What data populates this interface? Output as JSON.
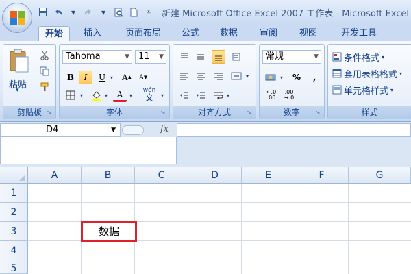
{
  "window": {
    "title": "新建 Microsoft Office Excel 2007 工作表 - Microsoft Excel"
  },
  "quick_access": {
    "save_icon": "save-icon",
    "undo_icon": "undo-icon",
    "redo_icon": "redo-icon",
    "print_preview_icon": "print-preview-icon",
    "new_icon": "new-document-icon",
    "more_glyph": "▾"
  },
  "tabs": [
    {
      "label": "开始",
      "active": true
    },
    {
      "label": "插入"
    },
    {
      "label": "页面布局"
    },
    {
      "label": "公式"
    },
    {
      "label": "数据"
    },
    {
      "label": "审阅"
    },
    {
      "label": "视图"
    },
    {
      "label": "开发工具"
    }
  ],
  "ribbon": {
    "clipboard": {
      "label": "剪贴板",
      "paste_label": "粘贴",
      "cut_icon": "scissors-icon",
      "copy_icon": "copy-icon",
      "format_painter_icon": "format-painter-icon"
    },
    "font": {
      "label": "字体",
      "font_name": "Tahoma",
      "font_size": "11",
      "bold": "B",
      "italic": "I",
      "underline": "U",
      "grow": "A",
      "shrink": "A",
      "font_color": "A",
      "phonetic": "wén"
    },
    "alignment": {
      "label": "对齐方式"
    },
    "number": {
      "label": "数字",
      "format": "常规",
      "percent": "%",
      "comma": ","
    },
    "styles": {
      "label": "样式",
      "conditional_format": "条件格式",
      "table_format": "套用表格格式",
      "cell_styles": "单元格样式"
    }
  },
  "formula_bar": {
    "name_box": "D4",
    "fx": "fx",
    "value": ""
  },
  "grid": {
    "columns": [
      "A",
      "B",
      "C",
      "D",
      "E",
      "F",
      "G"
    ],
    "rows": [
      "1",
      "2",
      "3",
      "4",
      "5"
    ],
    "highlighted_cell": {
      "ref": "B3",
      "value": "数据",
      "border_color": "#e0202c"
    }
  },
  "colors": {
    "accent": "#15428b",
    "highlight_red": "#e0202c",
    "active_button": "#ffc659"
  }
}
